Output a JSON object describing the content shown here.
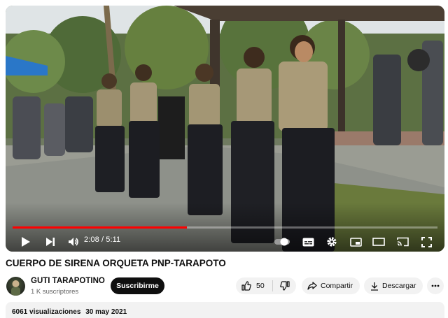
{
  "player": {
    "progress_fraction": 0.41,
    "time_current": "2:08",
    "time_separator": " / ",
    "time_total": "5:11",
    "controls": [
      "play-icon",
      "next-icon",
      "volume-icon",
      "autoplay-toggle",
      "subtitles-icon",
      "settings-icon",
      "miniplayer-icon",
      "theater-icon",
      "cast-icon",
      "fullscreen-icon"
    ]
  },
  "video": {
    "title": "CUERPO DE SIRENA ORQUETA PNP-TARAPOTO"
  },
  "channel": {
    "name": "GUTI TARAPOTINO",
    "subscribers": "1 K suscriptores",
    "subscribe_label": "Suscribirme"
  },
  "actions": {
    "like_count": "50",
    "share_label": "Compartir",
    "download_label": "Descargar"
  },
  "description": {
    "views": "6061 visualizaciones",
    "date": "30 may 2021"
  },
  "colors": {
    "progress": "#ff0000",
    "subscribe_bg": "#0f0f0f",
    "pill_bg": "#f2f2f2"
  }
}
